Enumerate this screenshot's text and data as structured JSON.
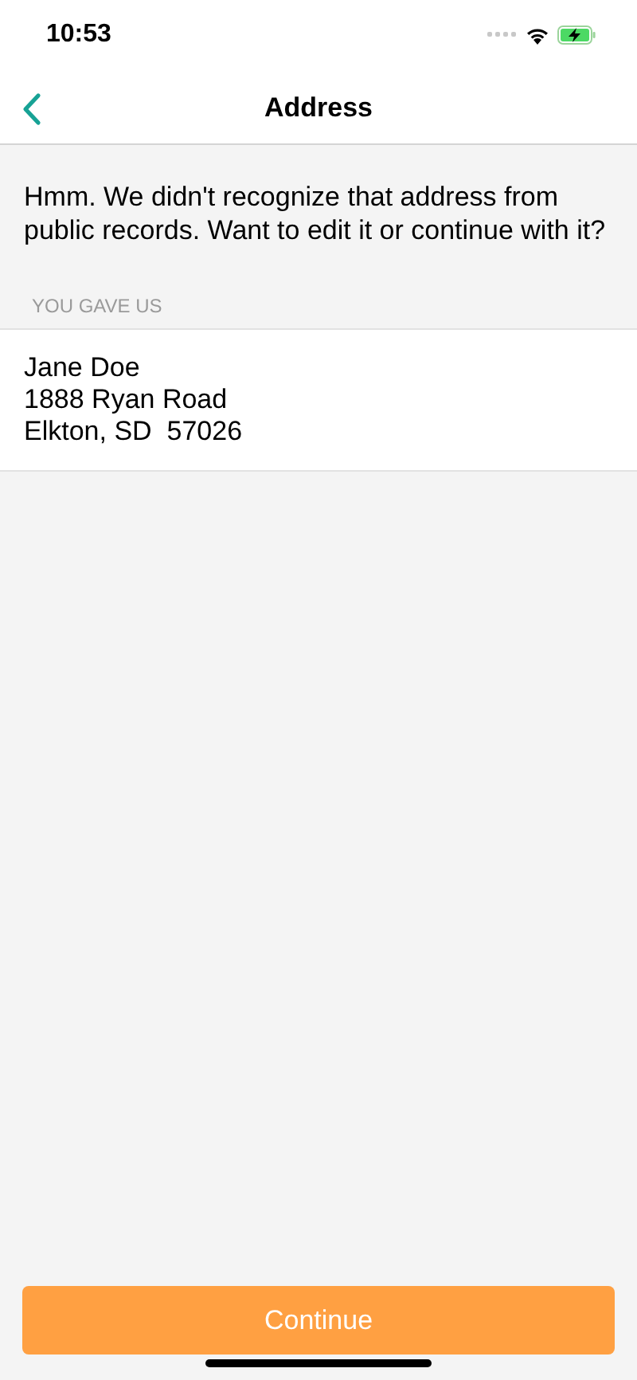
{
  "status_bar": {
    "time": "10:53"
  },
  "nav": {
    "title": "Address"
  },
  "message": "Hmm. We didn't recognize that address from public records. Want to edit it or continue with it?",
  "section": {
    "header": "YOU GAVE US",
    "lines": [
      "Jane Doe",
      "1888 Ryan Road",
      "Elkton, SD  57026"
    ]
  },
  "primary_button": {
    "label": "Continue"
  }
}
